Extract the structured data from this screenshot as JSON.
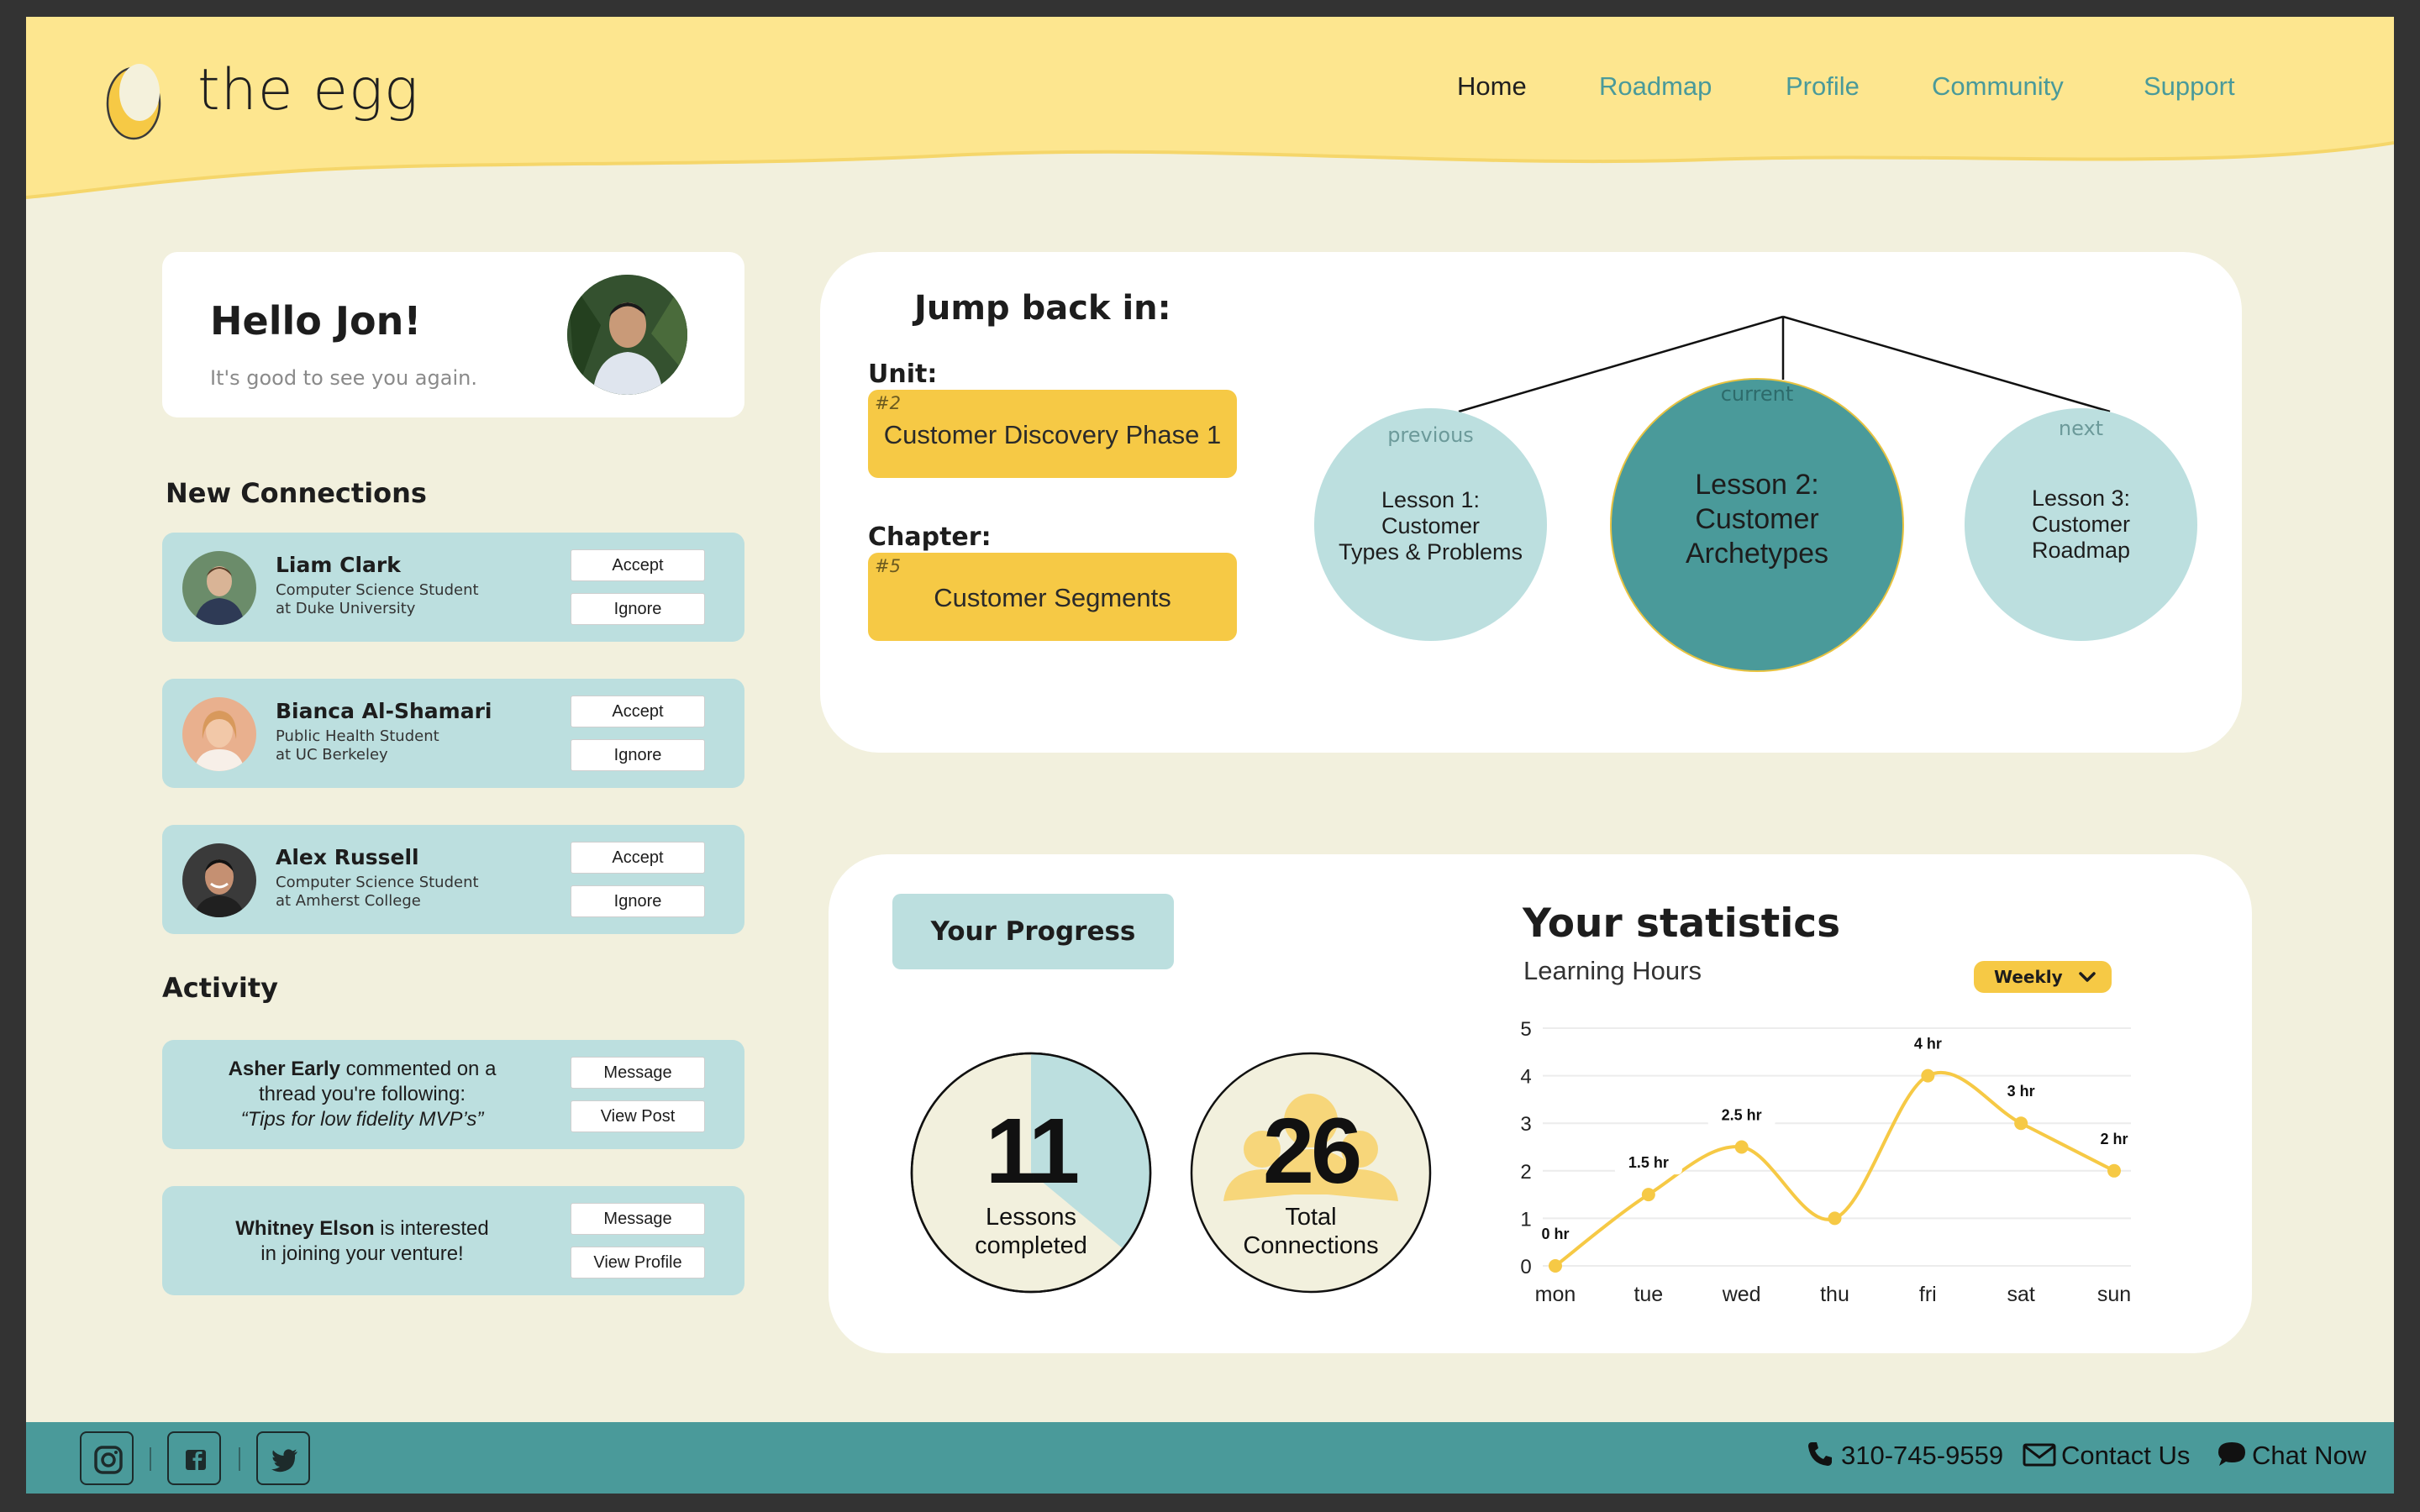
{
  "app": {
    "name": "the egg"
  },
  "nav": {
    "items": [
      "Home",
      "Roadmap",
      "Profile",
      "Community",
      "Support"
    ],
    "active": "Home"
  },
  "greeting": {
    "title": "Hello Jon!",
    "subtitle": "It's good to see you again."
  },
  "connections": {
    "title": "New Connections",
    "items": [
      {
        "name": "Liam Clark",
        "line1": "Computer Science Student",
        "line2": "at Duke University",
        "accept": "Accept",
        "ignore": "Ignore"
      },
      {
        "name": "Bianca Al-Shamari",
        "line1": "Public Health Student",
        "line2": "at UC Berkeley",
        "accept": "Accept",
        "ignore": "Ignore"
      },
      {
        "name": "Alex Russell",
        "line1": "Computer Science Student",
        "line2": "at Amherst College",
        "accept": "Accept",
        "ignore": "Ignore"
      }
    ]
  },
  "activity": {
    "title": "Activity",
    "items": [
      {
        "actor": "Asher Early",
        "text1": " commented on a",
        "text2": "thread you're following:",
        "text3": "“Tips for low fidelity MVP’s”",
        "btn1": "Message",
        "btn2": "View Post"
      },
      {
        "actor": "Whitney Elson",
        "text1": " is interested",
        "text2": "in joining your venture!",
        "btn1": "Message",
        "btn2": "View Profile"
      }
    ]
  },
  "jump": {
    "title": "Jump back in:",
    "unit_label": "Unit:",
    "unit_num": "#2",
    "unit_value": "Customer Discovery Phase 1",
    "chapter_label": "Chapter:",
    "chapter_num": "#5",
    "chapter_value": "Customer Segments",
    "lessons": [
      {
        "tag": "previous",
        "l1": "Lesson 1:",
        "l2": "Customer",
        "l3": "Types & Problems"
      },
      {
        "tag": "current",
        "l1": "Lesson 2:",
        "l2": "Customer",
        "l3": "Archetypes"
      },
      {
        "tag": "next",
        "l1": "Lesson 3:",
        "l2": "Customer",
        "l3": "Roadmap"
      }
    ]
  },
  "progress": {
    "button": "Your Progress",
    "lessons": {
      "value": "11",
      "l1": "Lessons",
      "l2": "completed",
      "fraction": 0.36
    },
    "connections": {
      "value": "26",
      "l1": "Total",
      "l2": "Connections"
    }
  },
  "stats": {
    "title": "Your statistics",
    "subtitle": "Learning Hours",
    "period": "Weekly"
  },
  "chart_data": {
    "type": "line",
    "title": "Learning Hours",
    "categories": [
      "mon",
      "tue",
      "wed",
      "thu",
      "fri",
      "sat",
      "sun"
    ],
    "series": [
      {
        "values": [
          0,
          1.5,
          2.5,
          1,
          4,
          3,
          2
        ]
      }
    ],
    "data_labels": [
      "0 hr",
      "1.5 hr",
      "2.5 hr",
      "",
      "4 hr",
      "3 hr",
      "2 hr"
    ],
    "ylim": [
      0,
      5
    ],
    "yticks": [
      0,
      1,
      2,
      3,
      4,
      5
    ],
    "grid": true
  },
  "footer": {
    "phone": "310-745-9559",
    "contact": "Contact Us",
    "chat": "Chat Now"
  },
  "colors": {
    "yellow": "#F6C945",
    "teal": "#4A9A9A",
    "light_teal": "#BCDFDF",
    "cream": "#F2F0DD",
    "header": "#FDE68F"
  },
  "icons": [
    "egg-logo-icon",
    "instagram-icon",
    "facebook-icon",
    "twitter-icon",
    "phone-icon",
    "mail-icon",
    "chat-icon",
    "chevron-down-icon"
  ]
}
